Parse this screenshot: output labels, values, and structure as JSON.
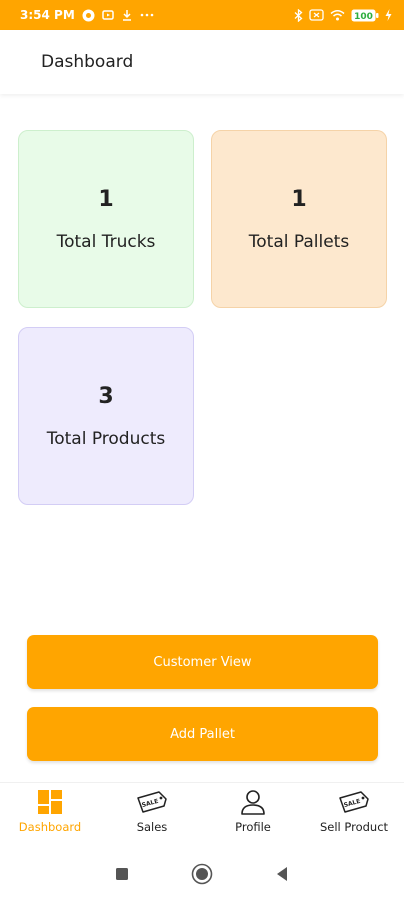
{
  "status_bar": {
    "time": "3:54 PM",
    "battery": "100"
  },
  "app_bar": {
    "title": "Dashboard"
  },
  "stats": {
    "trucks": {
      "value": "1",
      "label": "Total Trucks"
    },
    "pallets": {
      "value": "1",
      "label": "Total Pallets"
    },
    "products": {
      "value": "3",
      "label": "Total Products"
    }
  },
  "buttons": {
    "customer_view": "Customer View",
    "add_pallet": "Add Pallet"
  },
  "bottom_nav": {
    "items": [
      {
        "label": "Dashboard",
        "icon": "dashboard-grid-icon",
        "active": true
      },
      {
        "label": "Sales",
        "icon": "sale-tag-icon"
      },
      {
        "label": "Profile",
        "icon": "person-icon"
      },
      {
        "label": "Sell Product",
        "icon": "sale-tag-icon"
      }
    ]
  },
  "colors": {
    "accent": "#FFA500",
    "trucks_bg": "#E8FBE8",
    "pallets_bg": "#FDE8CE",
    "products_bg": "#EEEBFD"
  }
}
